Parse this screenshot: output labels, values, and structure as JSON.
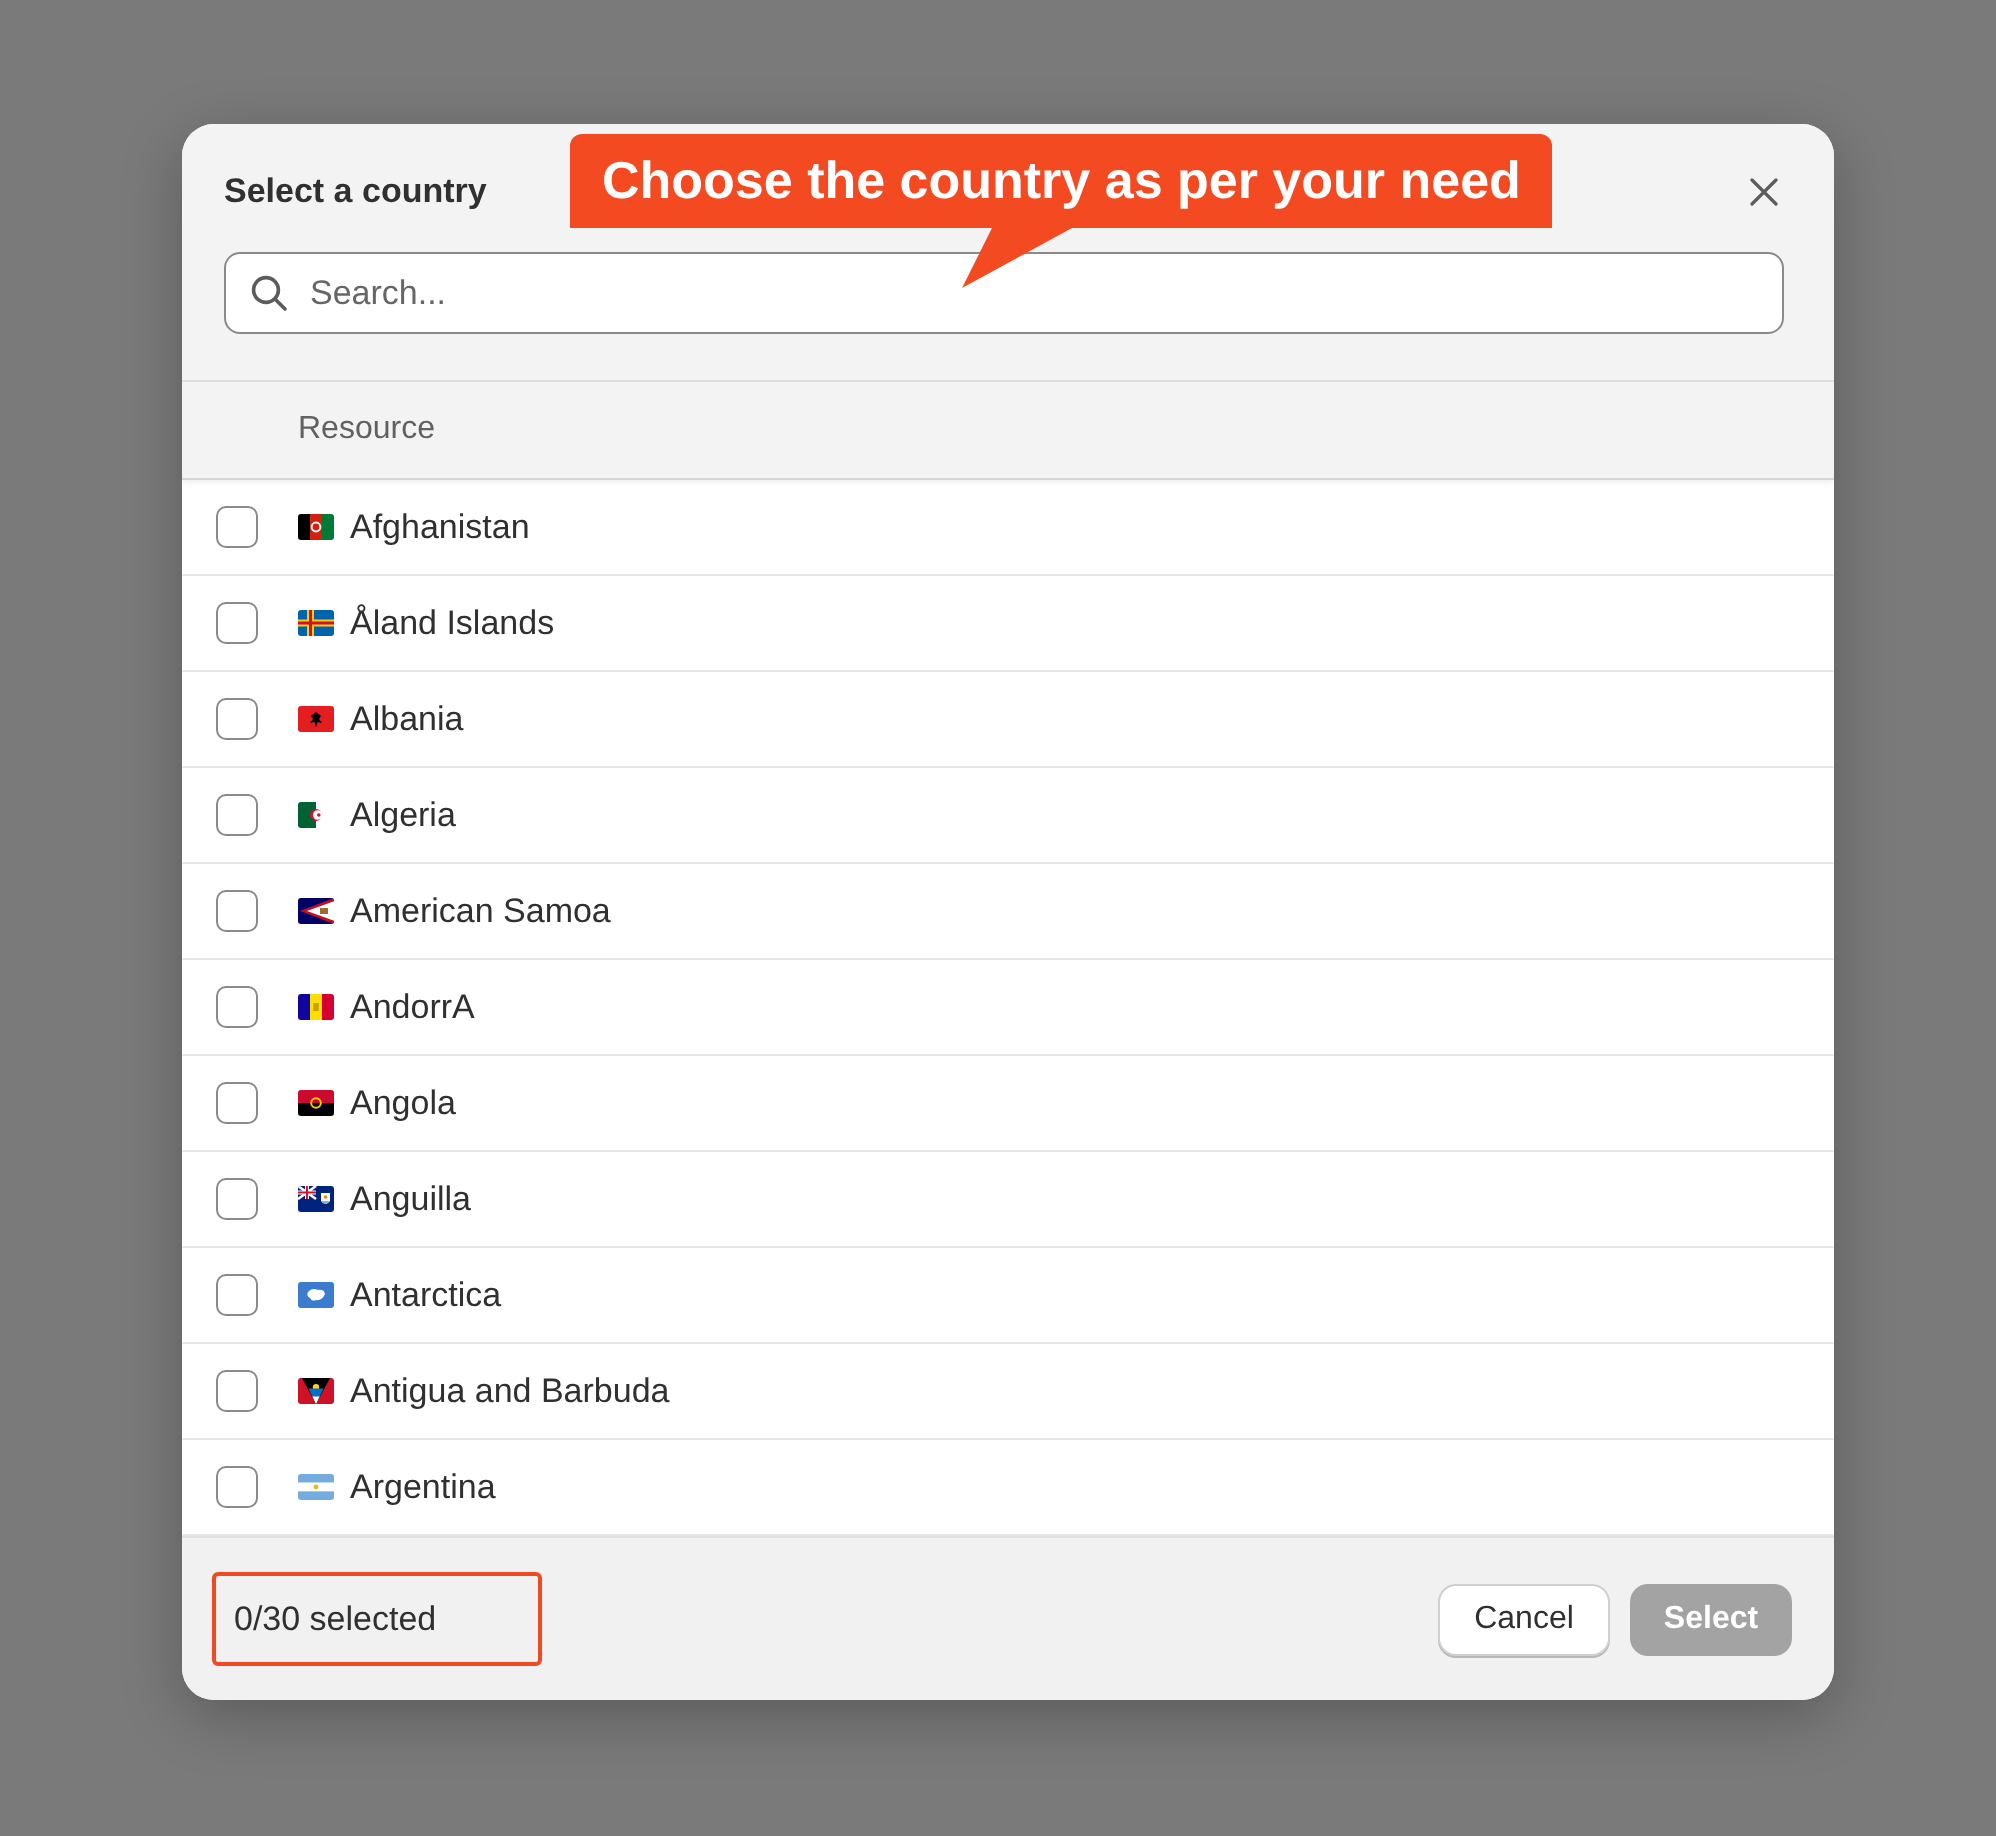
{
  "dialog": {
    "title": "Select a country",
    "search": {
      "placeholder": "Search..."
    }
  },
  "callout": {
    "text": "Choose the country as per your need"
  },
  "table": {
    "columns": [
      "Resource"
    ],
    "rows": [
      {
        "name": "Afghanistan",
        "kind": "af",
        "checked": false
      },
      {
        "name": "Åland Islands",
        "kind": "ax",
        "checked": false
      },
      {
        "name": "Albania",
        "kind": "al",
        "checked": false
      },
      {
        "name": "Algeria",
        "kind": "dz",
        "checked": false
      },
      {
        "name": "American Samoa",
        "kind": "as",
        "checked": false
      },
      {
        "name": "AndorrA",
        "kind": "ad",
        "checked": false
      },
      {
        "name": "Angola",
        "kind": "ao",
        "checked": false
      },
      {
        "name": "Anguilla",
        "kind": "ai",
        "checked": false
      },
      {
        "name": "Antarctica",
        "kind": "aq",
        "checked": false
      },
      {
        "name": "Antigua and Barbuda",
        "kind": "ag",
        "checked": false
      },
      {
        "name": "Argentina",
        "kind": "ar",
        "checked": false
      }
    ]
  },
  "footer": {
    "selection_count": {
      "text": "0/30 selected",
      "highlighted": true
    },
    "buttons": [
      {
        "label": "Cancel",
        "kind": "secondary",
        "disabled": false
      },
      {
        "label": "Select",
        "kind": "primary",
        "disabled": true
      }
    ]
  }
}
